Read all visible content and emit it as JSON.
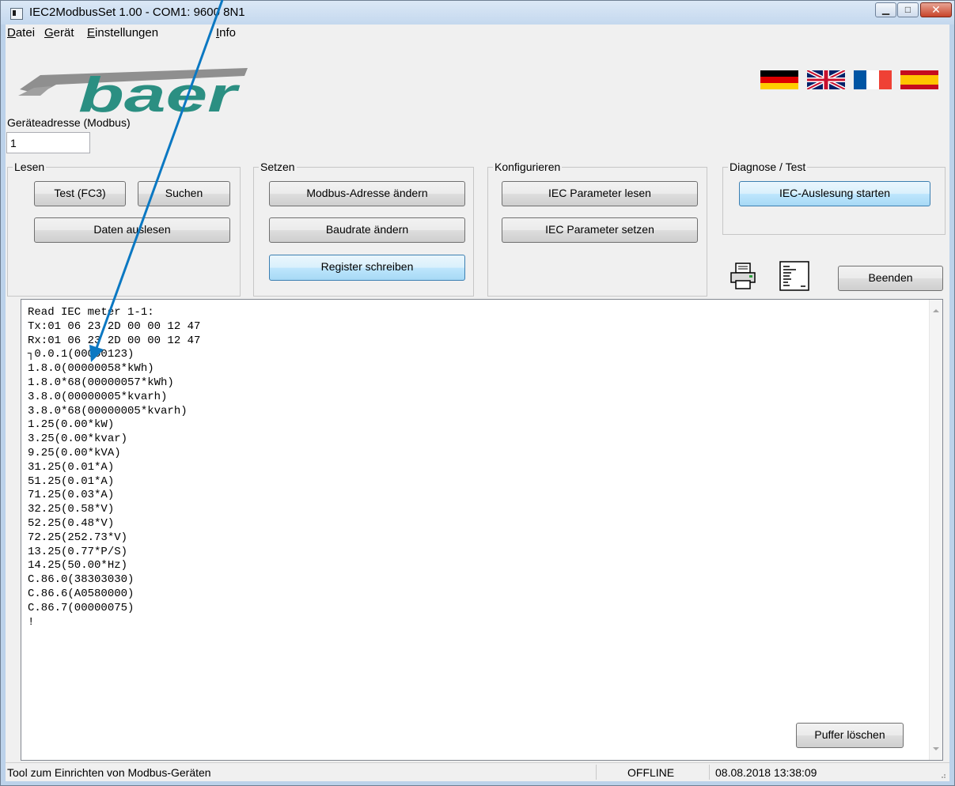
{
  "window": {
    "title": "IEC2ModbusSet 1.00 - COM1: 9600 8N1",
    "minimize_glyph": "▁",
    "maximize_glyph": "□",
    "close_glyph": "✕"
  },
  "menu": [
    {
      "label": "Datei",
      "accel": "D",
      "rest": "atei"
    },
    {
      "label": "Gerät",
      "accel": "G",
      "rest": "erät"
    },
    {
      "label": "Einstellungen",
      "accel": "E",
      "rest": "instellungen"
    },
    {
      "label": "Info",
      "accel": "I",
      "rest": "nfo"
    }
  ],
  "logo": {
    "text": "baer",
    "colors": {
      "stripe": "#8a8a8a",
      "text": "#2b8f82"
    }
  },
  "flags": [
    "germany",
    "united-kingdom",
    "france",
    "spain"
  ],
  "device_address": {
    "label": "Geräteadresse (Modbus)",
    "value": "1"
  },
  "groups": {
    "lesen": {
      "title": "Lesen",
      "test": "Test (FC3)",
      "search": "Suchen",
      "read_data": "Daten auslesen"
    },
    "setzen": {
      "title": "Setzen",
      "change_address": "Modbus-Adresse ändern",
      "change_baud": "Baudrate ändern",
      "write_register": "Register schreiben"
    },
    "konfigurieren": {
      "title": "Konfigurieren",
      "read_iec": "IEC Parameter lesen",
      "set_iec": "IEC Parameter setzen"
    },
    "diagnose": {
      "title": "Diagnose / Test",
      "start_iec": "IEC-Auslesung starten"
    }
  },
  "toolbar": {
    "print_icon": "printer-icon",
    "log_icon": "document-icon",
    "exit": "Beenden"
  },
  "log": {
    "lines": [
      "Read IEC meter 1-1:",
      "Tx:01 06 23 2D 00 00 12 47",
      "Rx:01 06 23 2D 00 00 12 47",
      "┐0.0.1(00000123)",
      "1.8.0(00000058*kWh)",
      "1.8.0*68(00000057*kWh)",
      "3.8.0(00000005*kvarh)",
      "3.8.0*68(00000005*kvarh)",
      "1.25(0.00*kW)",
      "3.25(0.00*kvar)",
      "9.25(0.00*kVA)",
      "31.25(0.01*A)",
      "51.25(0.01*A)",
      "71.25(0.03*A)",
      "32.25(0.58*V)",
      "52.25(0.48*V)",
      "72.25(252.73*V)",
      "13.25(0.77*P/S)",
      "14.25(50.00*Hz)",
      "C.86.0(38303030)",
      "C.86.6(A0580000)",
      "C.86.7(00000075)",
      "!"
    ],
    "clear_button": "Puffer löschen"
  },
  "status": {
    "text": "Tool zum Einrichten von Modbus-Geräten",
    "connection": "OFFLINE",
    "datetime": "08.08.2018 13:38:09"
  },
  "colors": {
    "arrow": "#0b78c2"
  }
}
